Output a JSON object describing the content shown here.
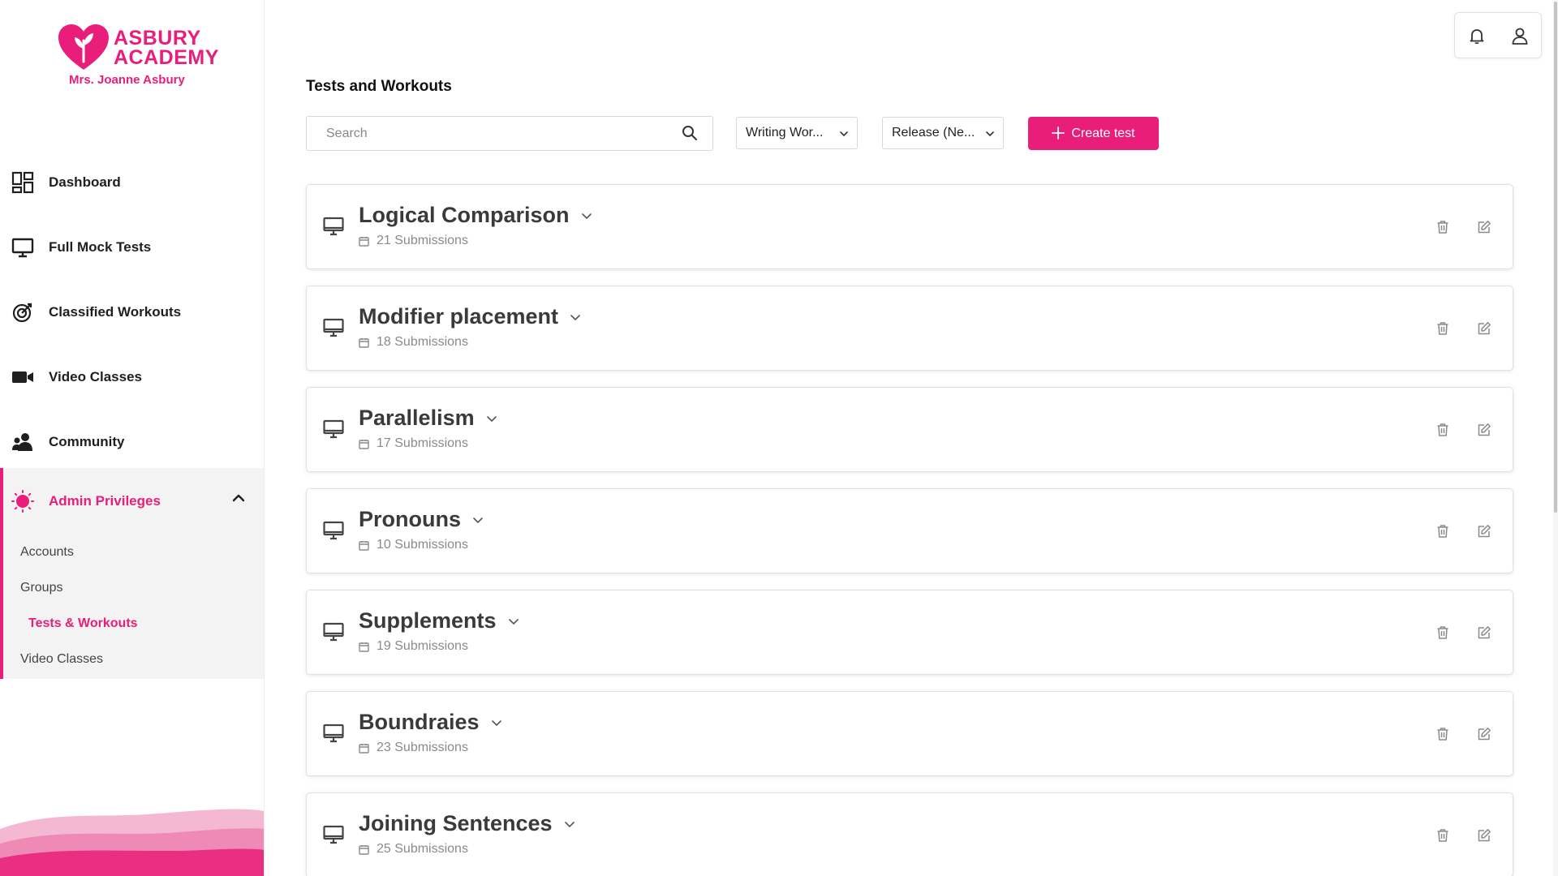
{
  "brand": {
    "name_line1": "ASBURY",
    "name_line2": "ACADEMY",
    "subtitle": "Mrs. Joanne Asbury",
    "accent_color": "#e91e7a"
  },
  "sidebar": {
    "items": [
      {
        "label": "Dashboard",
        "icon": "dashboard-icon"
      },
      {
        "label": "Full Mock Tests",
        "icon": "monitor-icon"
      },
      {
        "label": "Classified Workouts",
        "icon": "target-icon"
      },
      {
        "label": "Video Classes",
        "icon": "video-camera-icon"
      },
      {
        "label": "Community",
        "icon": "community-icon"
      }
    ],
    "admin": {
      "label": "Admin Privileges",
      "icon": "admin-gear-icon",
      "expanded": true,
      "subitems": [
        {
          "label": "Accounts",
          "active": false
        },
        {
          "label": "Groups",
          "active": false
        },
        {
          "label": "Tests & Workouts",
          "active": true
        },
        {
          "label": "Video Classes",
          "active": false
        }
      ]
    }
  },
  "header": {
    "notification_icon": "bell-icon",
    "profile_icon": "user-icon"
  },
  "main": {
    "title": "Tests and Workouts",
    "search": {
      "placeholder": "Search",
      "value": ""
    },
    "filters": [
      {
        "value": "Writing Wor..."
      },
      {
        "value": "Release (Ne..."
      }
    ],
    "create_label": "Create test",
    "tests": [
      {
        "name": "Logical Comparison",
        "submissions": "21 Submissions"
      },
      {
        "name": "Modifier placement",
        "submissions": "18 Submissions"
      },
      {
        "name": "Parallelism",
        "submissions": "17 Submissions"
      },
      {
        "name": "Pronouns",
        "submissions": "10 Submissions"
      },
      {
        "name": "Supplements",
        "submissions": "19 Submissions"
      },
      {
        "name": "Boundraies",
        "submissions": "23 Submissions"
      },
      {
        "name": "Joining Sentences",
        "submissions": "25 Submissions"
      }
    ]
  }
}
